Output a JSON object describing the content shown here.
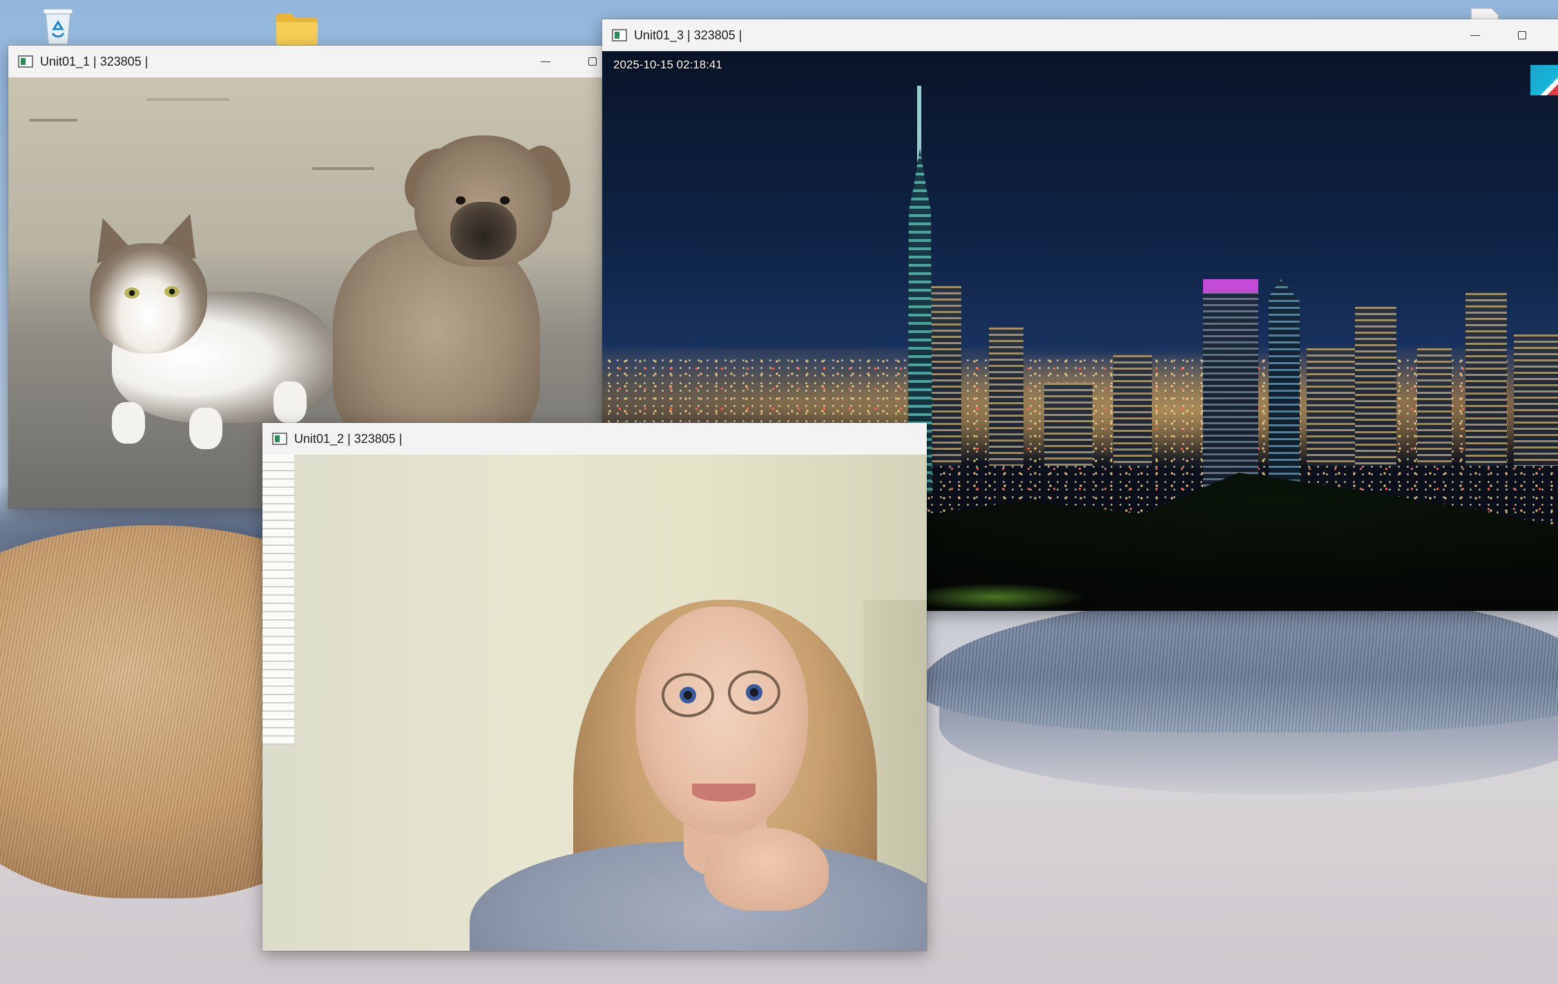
{
  "desktop": {
    "icons": [
      {
        "label": "",
        "icon": "recycle-bin-icon"
      },
      {
        "label": "",
        "icon": "folder-icon"
      },
      {
        "label": "",
        "icon": "document-icon"
      }
    ]
  },
  "windows": {
    "unit01_1": {
      "title": "Unit01_1 | 323805 |",
      "icon": "opencv-window-icon",
      "image_description": "cat-and-dog-photo"
    },
    "unit01_2": {
      "title": "Unit01_2 | 323805 |",
      "icon": "opencv-window-icon",
      "image_description": "webcam-frame"
    },
    "unit01_3": {
      "title": "Unit01_3 | 323805 |",
      "icon": "opencv-window-icon",
      "timestamp": "2025-10-15 02:18:41",
      "image_description": "taipei-skyline-night-stream",
      "controls": {
        "minimize": "minimize-icon",
        "maximize": "maximize-icon"
      }
    }
  },
  "colors": {
    "titlebar_bg": "#f3f3f3",
    "title_text": "#1e1e1e",
    "timestamp_text": "#ffffff"
  }
}
